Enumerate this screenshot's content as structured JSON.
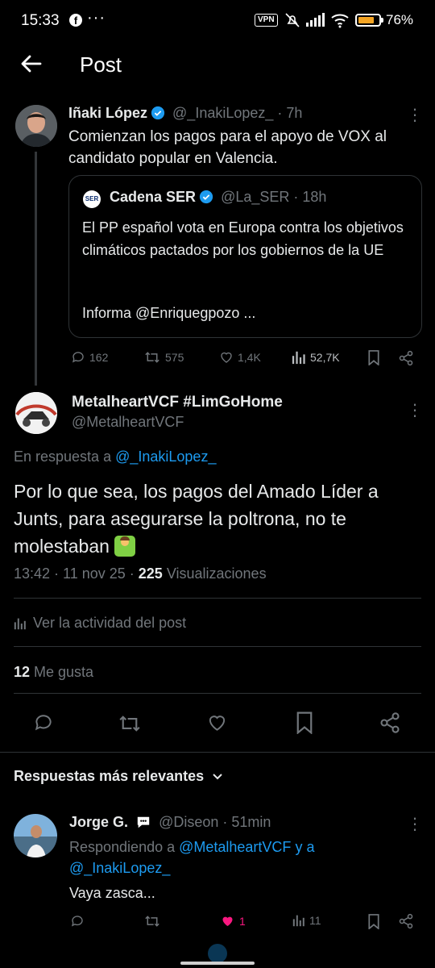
{
  "status_bar": {
    "time": "15:33",
    "facebook_icon": "f",
    "more_dots": "···",
    "vpn": "VPN",
    "battery_pct": "76%",
    "battery_level": 0.76
  },
  "header": {
    "title": "Post"
  },
  "parent_post": {
    "author_name": "Iñaki López",
    "handle_time": "@_InakiLopez_ · 7h",
    "text": "Comienzan los pagos para el apoyo de VOX al candidato popular en Valencia.",
    "quote": {
      "source_logo": "SER",
      "author_name": "Cadena SER",
      "handle_time": "@La_SER · 18h",
      "text": "El PP español vota en Europa contra los objetivos climáticos pactados por los gobiernos de la UE",
      "informa": "Informa @Enriquegpozo ..."
    },
    "actions": {
      "replies": "162",
      "retweets": "575",
      "likes": "1,4K",
      "views": "52,7K"
    }
  },
  "main_post": {
    "author_name": "MetalheartVCF #LimGoHome",
    "handle": "@MetalheartVCF",
    "reply_prefix": "En respuesta a ",
    "reply_to": "@_InakiLopez_",
    "text": "Por lo que sea, los pagos del Amado Líder a Junts, para asegurarse la poltrona, no te molestaban",
    "time_date": "13:42 · 11 nov 25 · ",
    "views_count": "225",
    "views_label": " Visualizaciones",
    "activity": "Ver la actividad del post",
    "likes_count": "12",
    "likes_label": " Me gusta"
  },
  "replies_section": {
    "label": "Respuestas más relevantes"
  },
  "reply": {
    "author_name": "Jorge G.",
    "handle_time": "@Diseon · 51min",
    "responding_prefix": "Respondiendo a ",
    "responding_to_1": "@MetalheartVCF",
    "responding_and": " y a",
    "responding_to_2": "@_InakiLopez_",
    "text": "Vaya zasca...",
    "actions": {
      "likes": "1",
      "views": "11"
    }
  },
  "colors": {
    "accent": "#1d9bf0",
    "like": "#f91880",
    "muted": "#71767b",
    "background": "#000000"
  }
}
